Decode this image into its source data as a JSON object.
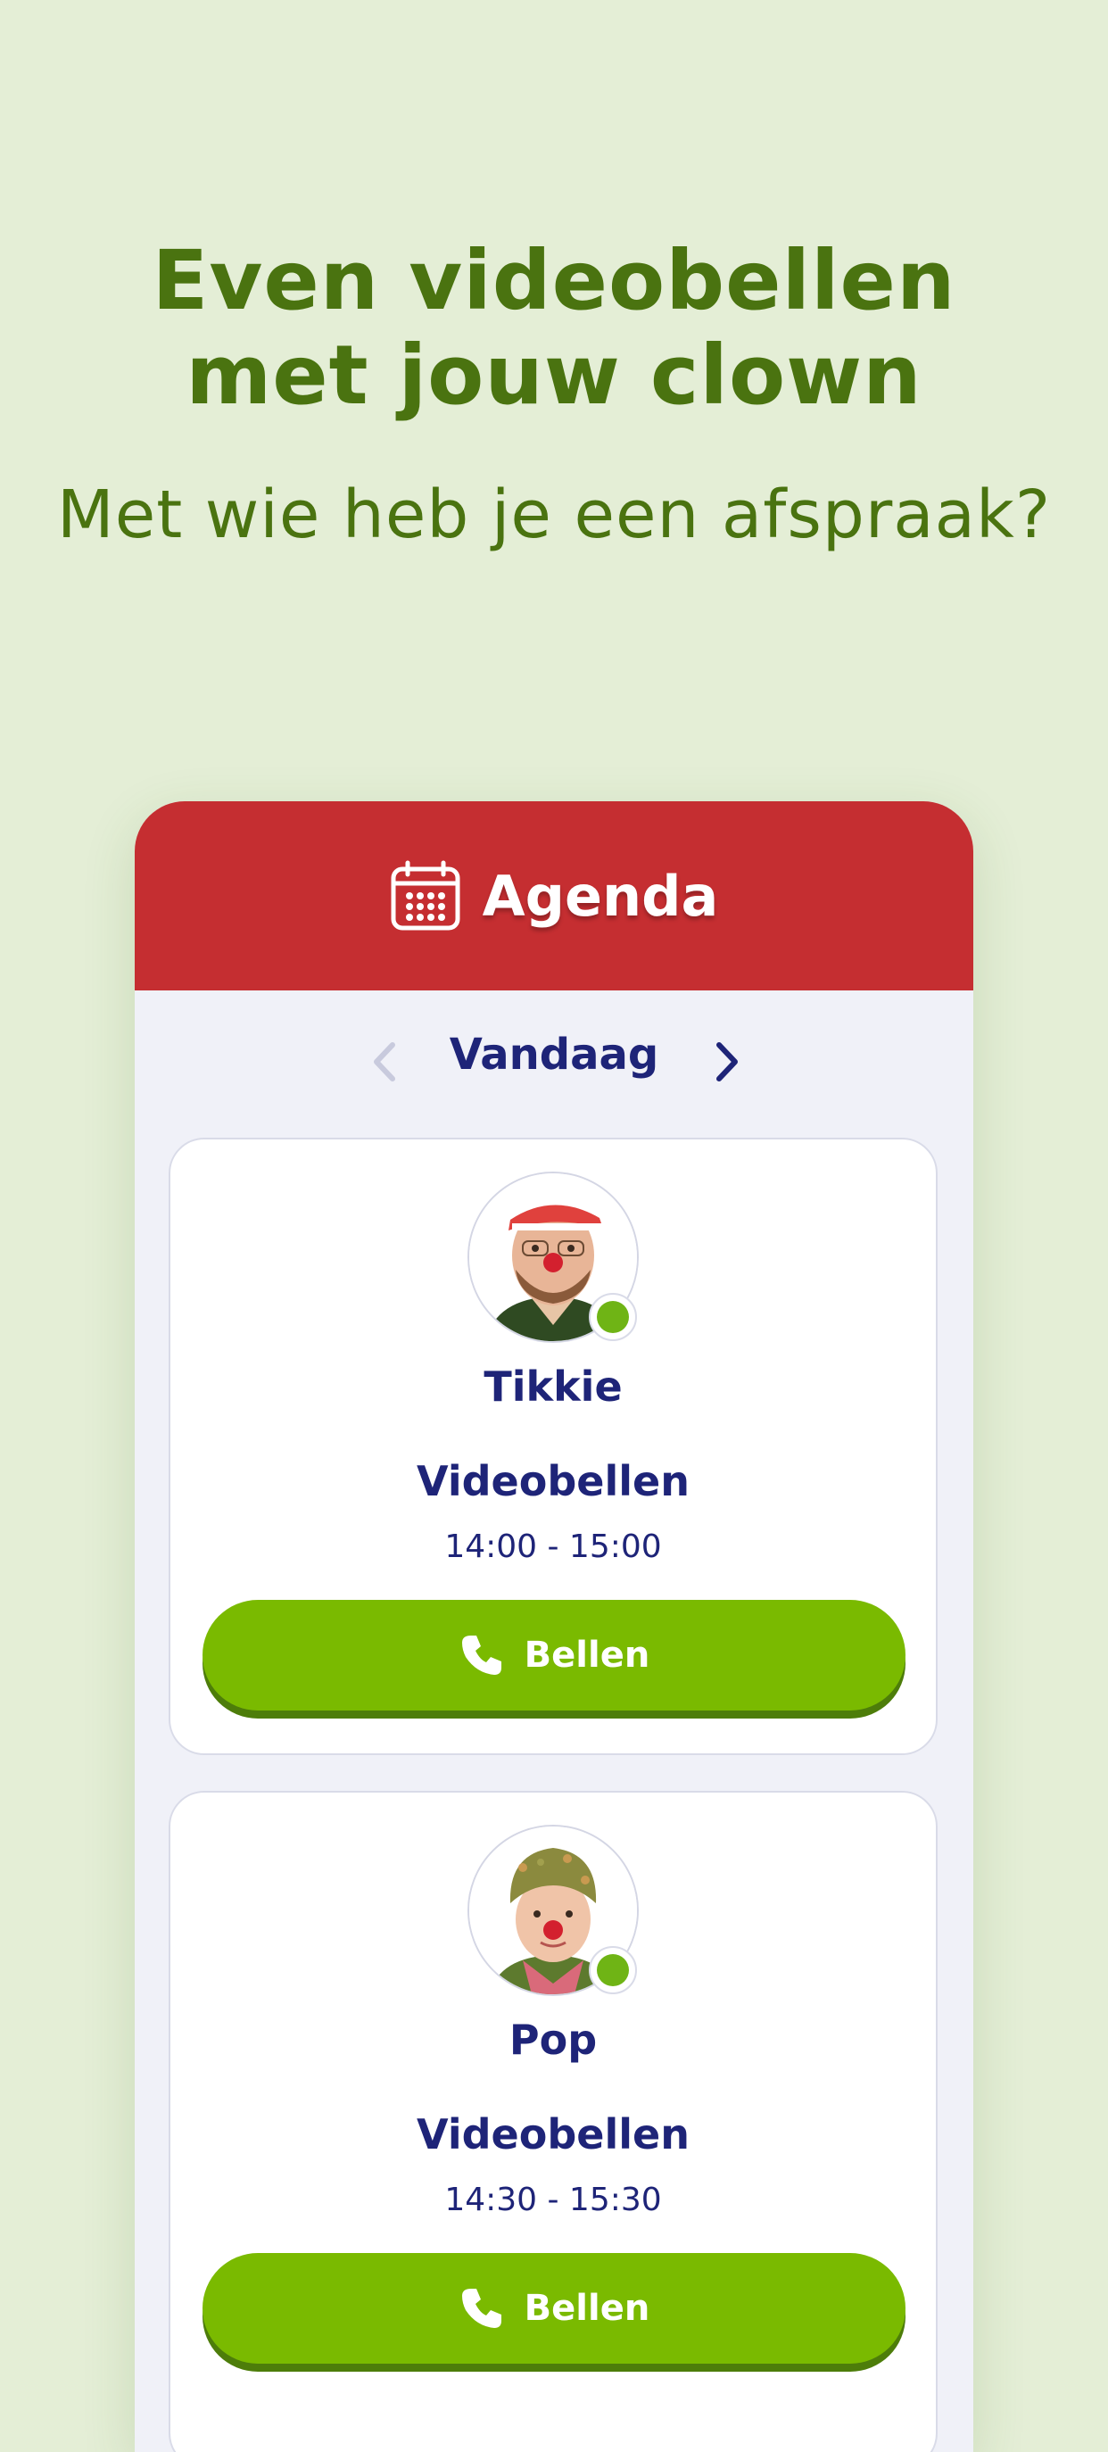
{
  "hero": {
    "title_line1": "Even videobellen",
    "title_line2": "met jouw clown",
    "subtitle": "Met wie heb je een afspraak?"
  },
  "agenda": {
    "title": "Agenda",
    "icon": "calendar-icon",
    "date_label": "Vandaag",
    "prev_icon": "chevron-left-icon",
    "next_icon": "chevron-right-icon",
    "header_color": "#c52e31"
  },
  "appointments": [
    {
      "name": "Tikkie",
      "type": "Videobellen",
      "time": "14:00 - 15:00",
      "button_label": "Bellen",
      "status": "online"
    },
    {
      "name": "Pop",
      "type": "Videobellen",
      "time": "14:30 - 15:30",
      "button_label": "Bellen",
      "status": "online"
    }
  ],
  "colors": {
    "background": "#e4eed6",
    "headline": "#4a7310",
    "text_dark": "#1e2478",
    "button": "#7aba00",
    "status_online": "#6fb415"
  }
}
